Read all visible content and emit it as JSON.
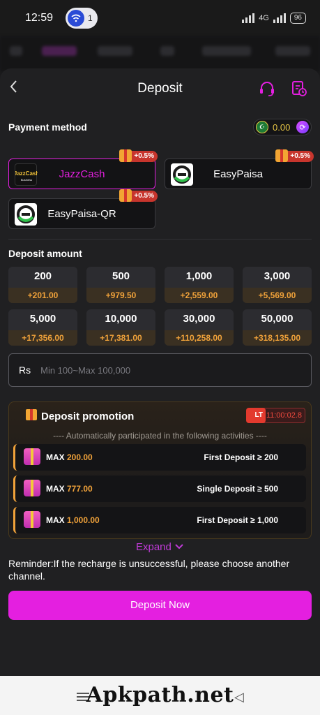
{
  "status_bar": {
    "time": "12:59",
    "notification_count": "1",
    "network": "4G",
    "battery": "96"
  },
  "header": {
    "title": "Deposit"
  },
  "payment": {
    "label": "Payment method",
    "balance": "0.00",
    "methods": [
      {
        "name": "JazzCash",
        "bonus": "+0.5%",
        "logo_text": "JazzCash",
        "selected": true
      },
      {
        "name": "EasyPaisa",
        "bonus": "+0.5%",
        "selected": false
      },
      {
        "name": "EasyPaisa-QR",
        "bonus": "+0.5%",
        "selected": false
      }
    ]
  },
  "deposit": {
    "label": "Deposit amount",
    "amounts": [
      {
        "value": "200",
        "bonus": "+201.00"
      },
      {
        "value": "500",
        "bonus": "+979.50"
      },
      {
        "value": "1,000",
        "bonus": "+2,559.00"
      },
      {
        "value": "3,000",
        "bonus": "+5,569.00"
      },
      {
        "value": "5,000",
        "bonus": "+17,356.00"
      },
      {
        "value": "10,000",
        "bonus": "+17,381.00"
      },
      {
        "value": "30,000",
        "bonus": "+110,258.00"
      },
      {
        "value": "50,000",
        "bonus": "+318,135.00"
      }
    ],
    "currency": "Rs",
    "placeholder": "Min 100~Max 100,000"
  },
  "promotion": {
    "title": "Deposit promotion",
    "timer_tag": "LT",
    "timer": "11:00:02.8",
    "subtitle": "---- Automatically participated in the following activities ----",
    "max_label": "MAX",
    "rows": [
      {
        "max": "200.00",
        "condition": "First Deposit ≥ 200"
      },
      {
        "max": "777.00",
        "condition": "Single Deposit ≥ 500"
      },
      {
        "max": "1,000.00",
        "condition": "First Deposit ≥ 1,000"
      }
    ],
    "expand": "Expand"
  },
  "reminder": "Reminder:If the recharge is unsuccessful, please choose another channel.",
  "button": {
    "deposit_now": "Deposit Now"
  },
  "watermark": "Apkpath.net",
  "colors": {
    "accent": "#e41fe0",
    "bonus": "#f0a23a",
    "background": "#202022"
  }
}
